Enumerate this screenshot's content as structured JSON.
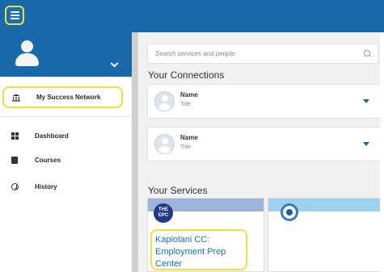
{
  "nav": {
    "items": [
      {
        "label": "My Success Network",
        "icon": "network-building-icon",
        "selected": true
      },
      {
        "label": "Dashboard",
        "icon": "dashboard-icon"
      },
      {
        "label": "Courses",
        "icon": "book-icon"
      },
      {
        "label": "History",
        "icon": "history-icon"
      }
    ]
  },
  "search": {
    "placeholder": "Search services and people"
  },
  "connections": {
    "title": "Your Connections",
    "items": [
      {
        "name": "Name",
        "title": "Title"
      },
      {
        "name": "Name",
        "title": "Title"
      }
    ]
  },
  "services": {
    "title": "Your Services",
    "items": [
      {
        "name": "Kapiolani CC: Employment Prep Center",
        "logo_text": "THE EPC",
        "band_color": "#9db3dc"
      },
      {
        "name": "",
        "band_color": "#9fd0ef"
      }
    ]
  },
  "colors": {
    "brand": "#1769aa",
    "highlight": "#f2df3c",
    "link": "#1a70c4"
  }
}
